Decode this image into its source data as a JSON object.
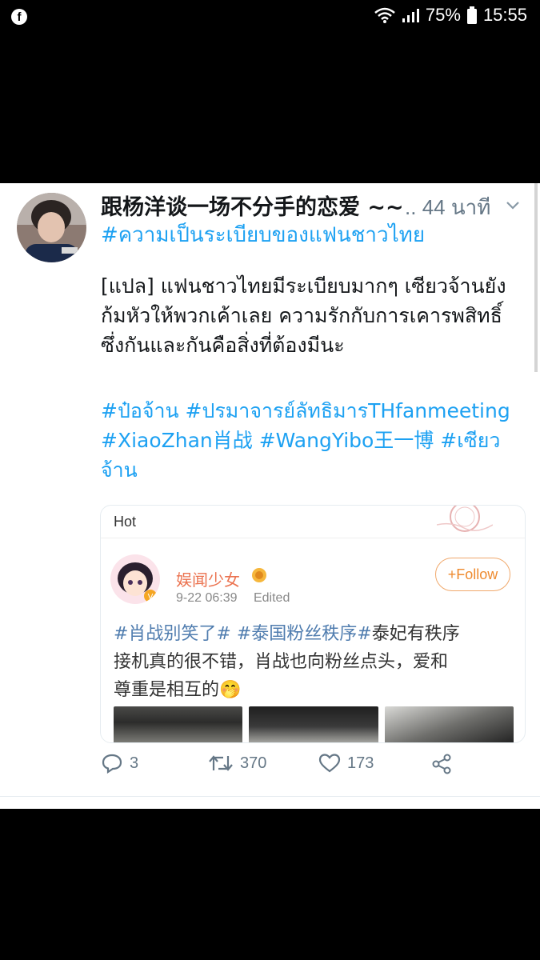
{
  "status_bar": {
    "app_icon": "facebook-icon",
    "battery": "75%",
    "time": "15:55"
  },
  "tweet": {
    "display_name": "跟杨洋谈一场不分手的恋爱 ~~",
    "time_prefix": "..",
    "time": "44 นาที",
    "hashtag_line": "#ความเป็นระเบียบของแฟนชาวไทย",
    "body_lines": [
      "[แปล] แฟนชาวไทยมีระเบียบมากๆ เซียวจ้านยัง",
      "ก้มหัวให้พวกเค้าเลย ความรักกับการเคารพสิทธิ์",
      "ซึ่งกันและกันคือสิ่งที่ต้องมีนะ"
    ],
    "tag_lines": [
      "#ป๋อจ้าน #ปรมาจารย์ลัทธิมารTHfanmeeting",
      "#XiaoZhan肖战 #WangYibo王一博 #เซียว",
      "จ้าน"
    ],
    "actions": {
      "reply_count": "3",
      "retweet_count": "370",
      "like_count": "173"
    }
  },
  "embed": {
    "hot_label": "Hot",
    "user_name": "娱闻少女",
    "time": "9-22 06:39",
    "edited": "Edited",
    "follow_label": "+Follow",
    "tag1": "#肖战别笑了#",
    "tag2": "#泰国粉丝秩序#",
    "text_1": "泰妃有秩序",
    "text_2": "接机真的很不错，肖战也向粉丝点头，爱和",
    "text_3": "尊重是相互的",
    "emoji": "🤭"
  },
  "colors": {
    "link": "#1da1f2",
    "weibo_tag": "#507daf",
    "weibo_name": "#eb7350",
    "follow": "#ee8a2e"
  }
}
